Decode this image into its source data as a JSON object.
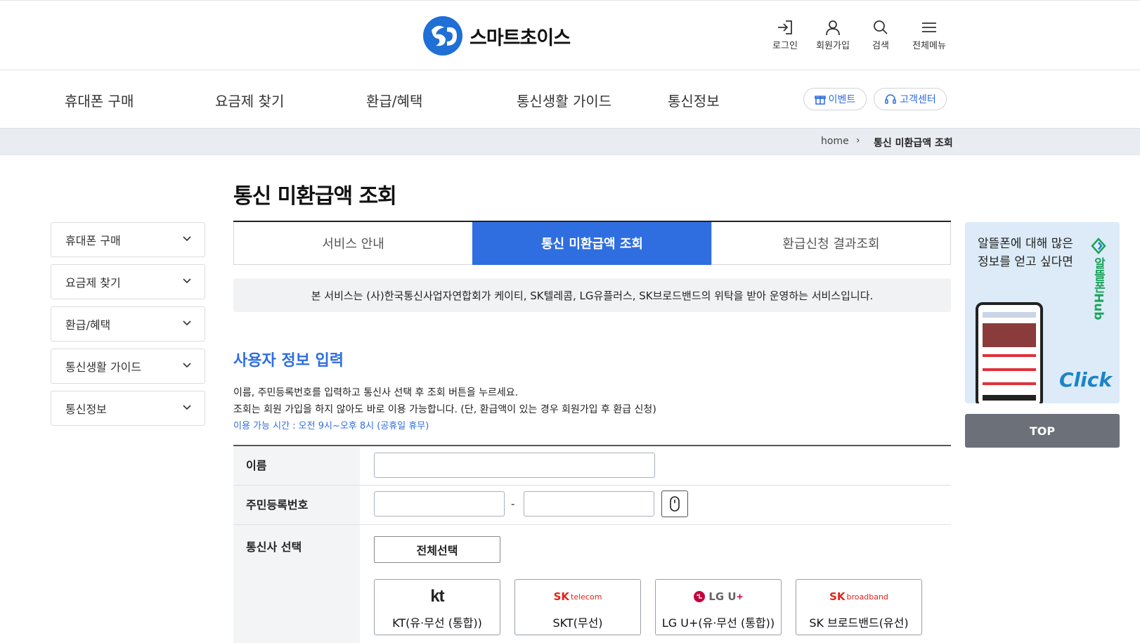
{
  "header": {
    "brand_name": "스마트초이스",
    "utils": [
      {
        "label": "로그인",
        "icon": "login-icon"
      },
      {
        "label": "회원가입",
        "icon": "user-icon"
      },
      {
        "label": "검색",
        "icon": "search-icon"
      },
      {
        "label": "전체메뉴",
        "icon": "menu-icon"
      }
    ]
  },
  "gnb": {
    "items": [
      "휴대폰 구매",
      "요금제 찾기",
      "환급/혜택",
      "통신생활 가이드",
      "통신정보"
    ],
    "event_label": "이벤트",
    "support_label": "고객센터"
  },
  "breadcrumb": {
    "home": "home",
    "current": "통신 미환급액 조회"
  },
  "sidebar": {
    "items": [
      "휴대폰 구매",
      "요금제 찾기",
      "환급/혜택",
      "통신생활 가이드",
      "통신정보"
    ]
  },
  "main": {
    "title": "통신 미환급액 조회",
    "tabs": [
      "서비스 안내",
      "통신 미환급액 조회",
      "환급신청 결과조회"
    ],
    "active_tab": 1,
    "notice": "본 서비스는 (사)한국통신사업자연합회가 케이티, SK텔레콤, LG유플러스, SK브로드밴드의 위탁을 받아 운영하는 서비스입니다.",
    "section_title": "사용자 정보 입력",
    "guide_1": "이름, 주민등록번호를 입력하고 통신사 선택 후 조회 버튼을 누르세요.",
    "guide_2": "조회는 회원 가입을 하지 않아도 바로 이용 가능합니다. (단, 환급액이 있는 경우 회원가입 후 환급 신청)",
    "guide_3": "이용 가능 시간 : 오전 9시~오후 8시 (공휴일 휴무)"
  },
  "form": {
    "name_label": "이름",
    "name_value": "",
    "rrn_label": "주민등록번호",
    "rrn_front_value": "",
    "rrn_back_value": "",
    "rrn_separator": "-",
    "carrier_label": "통신사 선택",
    "select_all_label": "전체선택",
    "carriers": [
      {
        "label": "KT(유·무선 (통합))",
        "logo": "kt"
      },
      {
        "label": "SKT(무선)",
        "logo_main": "SK",
        "logo_sub": "telecom"
      },
      {
        "label": "LG U+(유·무선 (통합))",
        "logo_main": "LG U",
        "logo_sup": "+"
      },
      {
        "label": "SK 브로드밴드(유선)",
        "logo_main": "SK",
        "logo_sub": "broadband"
      }
    ]
  },
  "banner": {
    "text": "알뜰폰에 대해 많은 정보를 얻고 싶다면",
    "brand": "알뜰폰Hub",
    "cta": "Click"
  },
  "top_button": "TOP",
  "colors": {
    "accent": "#2f6ee0",
    "banner_bg": "#dcebf7",
    "top_bg": "#6b7079"
  }
}
